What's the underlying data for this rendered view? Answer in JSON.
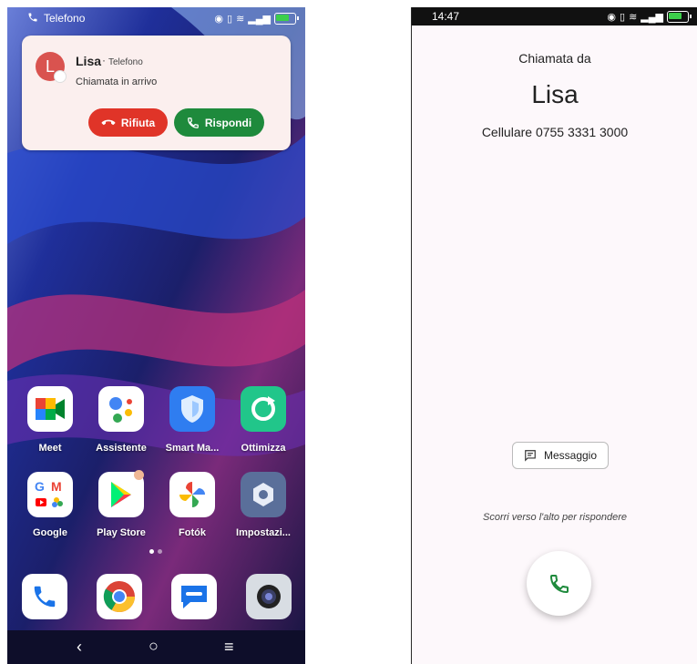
{
  "left": {
    "status_label": "Telefono",
    "notification": {
      "avatar_letter": "L",
      "caller": "Lisa",
      "separator": "·",
      "app": "Telefono",
      "message": "Chiamata in arrivo",
      "decline_label": "Rifiuta",
      "answer_label": "Rispondi"
    },
    "apps_row1": [
      "Meet",
      "Assistente",
      "Smart Ma...",
      "Ottimizza"
    ],
    "apps_row2": [
      "Google",
      "Play Store",
      "Fotók",
      "Impostazi..."
    ],
    "dock_icons": [
      "phone-icon",
      "chrome-icon",
      "messages-icon",
      "camera-icon"
    ],
    "colors": {
      "decline": "#e03428",
      "answer": "#1e8a3c",
      "avatar": "#d9534f"
    }
  },
  "right": {
    "time": "14:47",
    "incoming_label": "Chiamata da",
    "caller_name": "Lisa",
    "caller_number": "Cellulare 0755 3331 3000",
    "message_button": "Messaggio",
    "swipe_hint": "Scorri verso l'alto per rispondere",
    "colors": {
      "answer_icon": "#1e8a3c"
    }
  }
}
